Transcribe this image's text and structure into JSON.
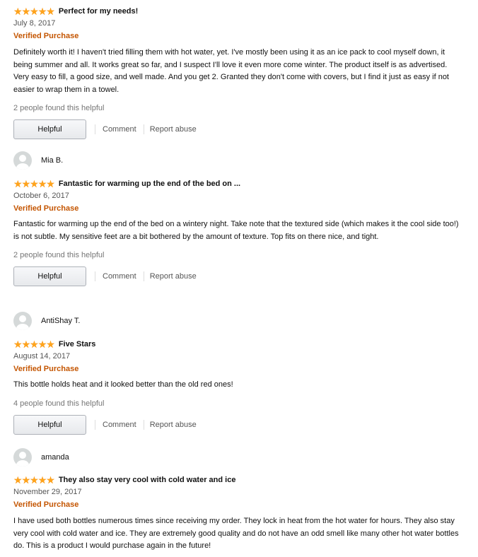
{
  "reviews": [
    {
      "user": null,
      "title": "Perfect for my needs!",
      "date": "July 8, 2017",
      "verified": "Verified Purchase",
      "body": "Definitely worth it! I haven't tried filling them with hot water, yet. I've mostly been using it as an ice pack to cool myself down, it being summer and all. It works great so far, and I suspect I'll love it even more come winter. The product itself is as advertised. Very easy to fill, a good size, and well made. And you get 2. Granted they don't come with covers, but I find it just as easy if not easier to wrap them in a towel.",
      "helpful_count": "2 people found this helpful",
      "rating": 5
    },
    {
      "user": "Mia B.",
      "title": "Fantastic for warming up the end of the bed on ...",
      "date": "October 6, 2017",
      "verified": "Verified Purchase",
      "body": "Fantastic for warming up the end of the bed on a wintery night. Take note that the textured side (which makes it the cool side too!) is not subtle. My sensitive feet are a bit bothered by the amount of texture. Top fits on there nice, and tight.",
      "helpful_count": "2 people found this helpful",
      "rating": 5
    },
    {
      "user": "AntiShay T.",
      "title": "Five Stars",
      "date": "August 14, 2017",
      "verified": "Verified Purchase",
      "body": "This bottle holds heat and it looked better than the old red ones!",
      "helpful_count": "4 people found this helpful",
      "rating": 5
    },
    {
      "user": "amanda",
      "title": "They also stay very cool with cold water and ice",
      "date": "November 29, 2017",
      "verified": "Verified Purchase",
      "body": "I have used both bottles numerous times since receiving my order. They lock in heat from the hot water for hours. They also stay very cool with cold water and ice. They are extremely good quality and do not have an odd smell like many other hot water bottles do. This is a product I would purchase again in the future!",
      "helpful_count": null,
      "rating": 5
    }
  ],
  "actions": {
    "helpful": "Helpful",
    "comment": "Comment",
    "report": "Report abuse"
  },
  "colors": {
    "star": "#ffa41c",
    "verified": "#c45500",
    "muted": "#767676"
  },
  "icons": {
    "star": "star-icon",
    "avatar": "default-avatar-icon"
  }
}
